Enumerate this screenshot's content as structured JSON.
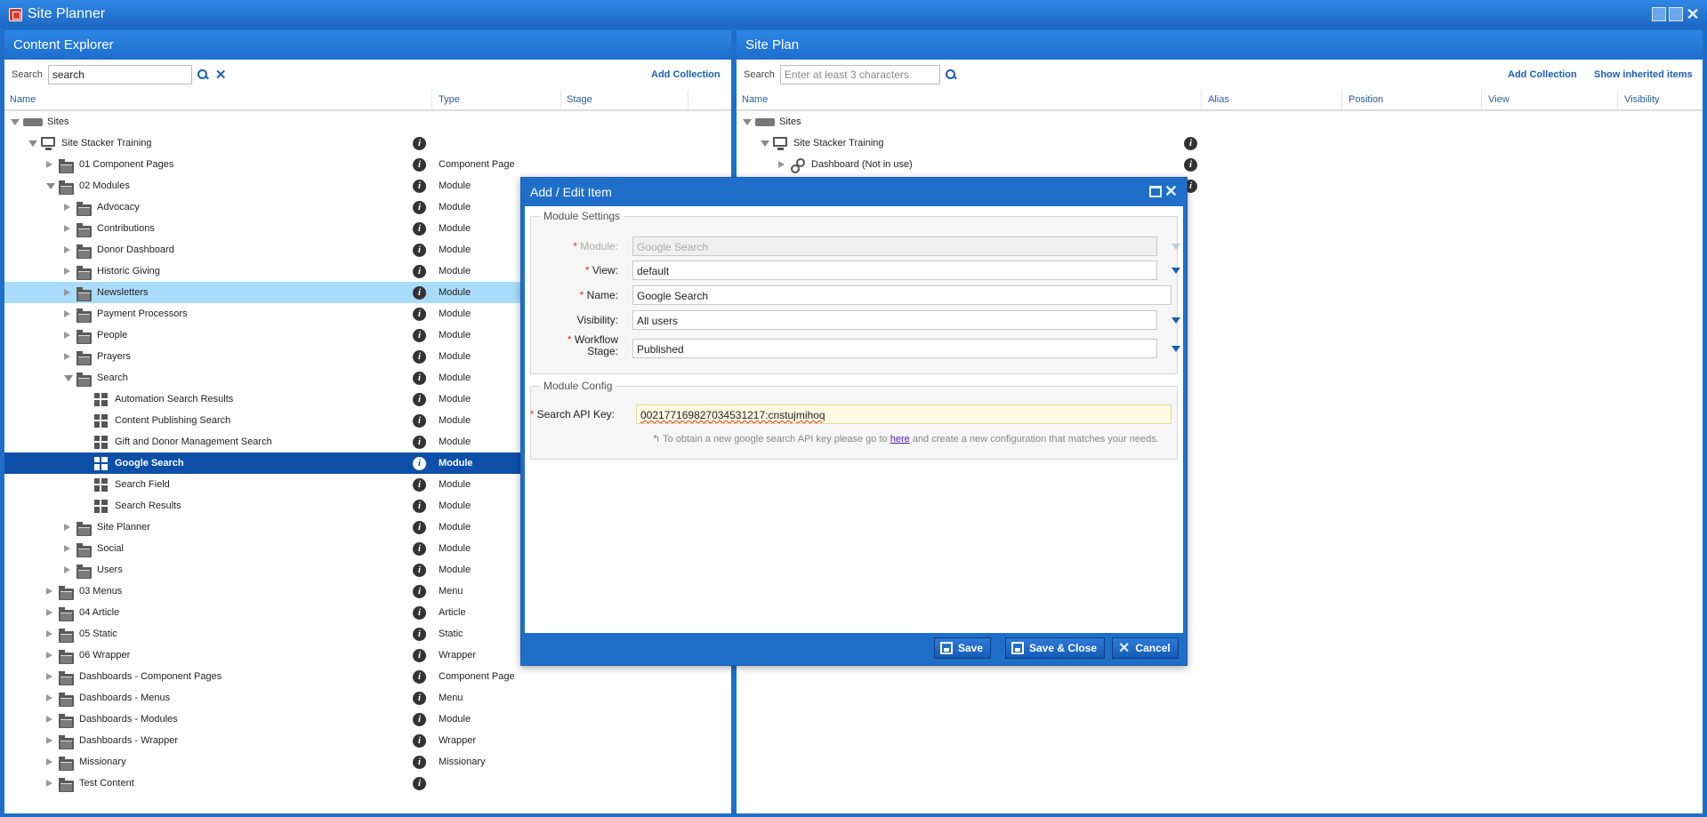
{
  "app": {
    "title": "Site Planner"
  },
  "explorer": {
    "title": "Content Explorer",
    "search_label": "Search",
    "search_value": "search",
    "add_collection": "Add Collection",
    "columns": {
      "name": "Name",
      "type": "Type",
      "stage": "Stage"
    },
    "rows": [
      {
        "label": "Sites",
        "type": "",
        "level": 0,
        "state": "expanded",
        "icon": "site-icon",
        "info": false
      },
      {
        "label": "Site Stacker Training",
        "type": "",
        "level": 1,
        "state": "expanded",
        "icon": "monitor-icon",
        "info": true
      },
      {
        "label": "01 Component Pages",
        "type": "Component Page",
        "level": 2,
        "state": "collapsed",
        "icon": "folder-icon",
        "info": true
      },
      {
        "label": "02 Modules",
        "type": "Module",
        "level": 2,
        "state": "expanded",
        "icon": "folder-icon",
        "info": true
      },
      {
        "label": "Advocacy",
        "type": "Module",
        "level": 3,
        "state": "collapsed",
        "icon": "folder-icon",
        "info": true
      },
      {
        "label": "Contributions",
        "type": "Module",
        "level": 3,
        "state": "collapsed",
        "icon": "folder-icon",
        "info": true
      },
      {
        "label": "Donor Dashboard",
        "type": "Module",
        "level": 3,
        "state": "collapsed",
        "icon": "folder-icon",
        "info": true
      },
      {
        "label": "Historic Giving",
        "type": "Module",
        "level": 3,
        "state": "collapsed",
        "icon": "folder-icon",
        "info": true
      },
      {
        "label": "Newsletters",
        "type": "Module",
        "level": 3,
        "state": "collapsed",
        "icon": "folder-icon",
        "info": true,
        "sel": "light"
      },
      {
        "label": "Payment Processors",
        "type": "Module",
        "level": 3,
        "state": "collapsed",
        "icon": "folder-icon",
        "info": true
      },
      {
        "label": "People",
        "type": "Module",
        "level": 3,
        "state": "collapsed",
        "icon": "folder-icon",
        "info": true
      },
      {
        "label": "Prayers",
        "type": "Module",
        "level": 3,
        "state": "collapsed",
        "icon": "folder-icon",
        "info": true
      },
      {
        "label": "Search",
        "type": "Module",
        "level": 3,
        "state": "expanded",
        "icon": "folder-icon",
        "info": true
      },
      {
        "label": "Automation Search Results",
        "type": "Module",
        "level": 4,
        "state": "leaf",
        "icon": "module-icon",
        "info": true
      },
      {
        "label": "Content Publishing Search",
        "type": "Module",
        "level": 4,
        "state": "leaf",
        "icon": "module-icon",
        "info": true
      },
      {
        "label": "Gift and Donor Management Search",
        "type": "Module",
        "level": 4,
        "state": "leaf",
        "icon": "module-icon",
        "info": true
      },
      {
        "label": "Google Search",
        "type": "Module",
        "level": 4,
        "state": "leaf",
        "icon": "module-icon",
        "info": true,
        "sel": "dark"
      },
      {
        "label": "Search Field",
        "type": "Module",
        "level": 4,
        "state": "leaf",
        "icon": "module-icon",
        "info": true
      },
      {
        "label": "Search Results",
        "type": "Module",
        "level": 4,
        "state": "leaf",
        "icon": "module-icon",
        "info": true
      },
      {
        "label": "Site Planner",
        "type": "Module",
        "level": 3,
        "state": "collapsed",
        "icon": "folder-icon",
        "info": true
      },
      {
        "label": "Social",
        "type": "Module",
        "level": 3,
        "state": "collapsed",
        "icon": "folder-icon",
        "info": true
      },
      {
        "label": "Users",
        "type": "Module",
        "level": 3,
        "state": "collapsed",
        "icon": "folder-icon",
        "info": true
      },
      {
        "label": "03 Menus",
        "type": "Menu",
        "level": 2,
        "state": "collapsed",
        "icon": "folder-icon",
        "info": true
      },
      {
        "label": "04 Article",
        "type": "Article",
        "level": 2,
        "state": "collapsed",
        "icon": "folder-icon",
        "info": true
      },
      {
        "label": "05 Static",
        "type": "Static",
        "level": 2,
        "state": "collapsed",
        "icon": "folder-icon",
        "info": true
      },
      {
        "label": "06 Wrapper",
        "type": "Wrapper",
        "level": 2,
        "state": "collapsed",
        "icon": "folder-icon",
        "info": true
      },
      {
        "label": "Dashboards - Component Pages",
        "type": "Component Page",
        "level": 2,
        "state": "collapsed",
        "icon": "folder-icon",
        "info": true
      },
      {
        "label": "Dashboards - Menus",
        "type": "Menu",
        "level": 2,
        "state": "collapsed",
        "icon": "folder-icon",
        "info": true
      },
      {
        "label": "Dashboards - Modules",
        "type": "Module",
        "level": 2,
        "state": "collapsed",
        "icon": "folder-icon",
        "info": true
      },
      {
        "label": "Dashboards - Wrapper",
        "type": "Wrapper",
        "level": 2,
        "state": "collapsed",
        "icon": "folder-icon",
        "info": true
      },
      {
        "label": "Missionary",
        "type": "Missionary",
        "level": 2,
        "state": "collapsed",
        "icon": "folder-icon",
        "info": true
      },
      {
        "label": "Test Content",
        "type": "",
        "level": 2,
        "state": "collapsed",
        "icon": "folder-icon",
        "info": true
      }
    ]
  },
  "siteplan": {
    "title": "Site Plan",
    "search_label": "Search",
    "search_placeholder": "Enter at least 3 characters",
    "add_collection": "Add Collection",
    "show_inherited": "Show inherited items",
    "columns": {
      "name": "Name",
      "alias": "Alias",
      "position": "Position",
      "view": "View",
      "visibility": "Visibility"
    },
    "rows": [
      {
        "label": "Sites",
        "level": 0,
        "state": "expanded",
        "icon": "site-icon",
        "info": false
      },
      {
        "label": "Site Stacker Training",
        "level": 1,
        "state": "expanded",
        "icon": "monitor-icon",
        "info": true
      },
      {
        "label": "Dashboard (Not in use)",
        "level": 2,
        "state": "collapsed",
        "icon": "link-icon",
        "info": true
      },
      {
        "label": "",
        "level": 2,
        "state": "none",
        "icon": "",
        "info": true
      }
    ]
  },
  "dialog": {
    "title": "Add / Edit Item",
    "module_settings_legend": "Module Settings",
    "module_label": "Module:",
    "module_value": "Google Search",
    "view_label": "View:",
    "view_value": "default",
    "name_label": "Name:",
    "name_value": "Google Search",
    "visibility_label": "Visibility:",
    "visibility_value": "All users",
    "workflow_label_1": "Workflow",
    "workflow_label_2": "Stage:",
    "workflow_value": "Published",
    "module_config_legend": "Module Config",
    "api_key_label": "Search API Key:",
    "api_key_value": "002177169827034531217:cnstujmihoq",
    "hint_before": "To obtain a new google search API key please go to",
    "hint_link": "here",
    "hint_after": "and create a new configuration that matches your needs.",
    "save": "Save",
    "save_close": "Save & Close",
    "cancel": "Cancel"
  }
}
